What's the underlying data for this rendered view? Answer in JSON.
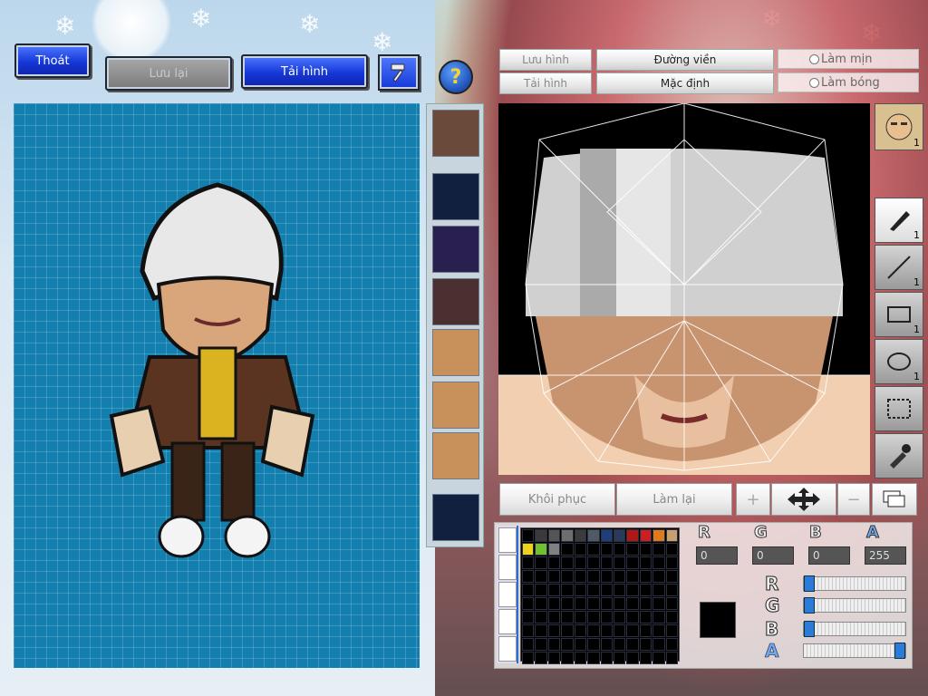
{
  "top_buttons": {
    "exit": "Thoát",
    "save": "Lưu lại",
    "load": "Tải hình"
  },
  "editor_top": {
    "save_image": "Lưu hình",
    "load_image": "Tải hình",
    "outline": "Đường viền",
    "default": "Mặc định",
    "smooth": "Làm mịn",
    "shade": "Làm bóng"
  },
  "tools": {
    "face_count": "1",
    "brush_count": "1",
    "line_count": "1",
    "rect_count": "1",
    "ellipse_count": "1"
  },
  "bottom_buttons": {
    "restore": "Khôi phục",
    "redo": "Làm lại"
  },
  "channels": {
    "r_label": "R",
    "g_label": "G",
    "b_label": "B",
    "a_label": "A",
    "r": "0",
    "g": "0",
    "b": "0",
    "a": "255"
  },
  "sliders": {
    "r": 0.0,
    "g": 0.0,
    "b": 0.0,
    "a": 1.0
  },
  "palette_colors": [
    "#000000",
    "#3a3a3a",
    "#555555",
    "#6e6e6e",
    "#3b3b3b",
    "#505a66",
    "#1f3f7a",
    "#2a3a5a",
    "#b01818",
    "#cc2020",
    "#e07a1a",
    "#c8a070",
    "#f0d020",
    "#70c030",
    "#808080",
    "#000000",
    "#000000",
    "#000000",
    "#000000",
    "#000000",
    "#000000",
    "#000000",
    "#000000",
    "#000000"
  ],
  "selected_color": "#000000"
}
